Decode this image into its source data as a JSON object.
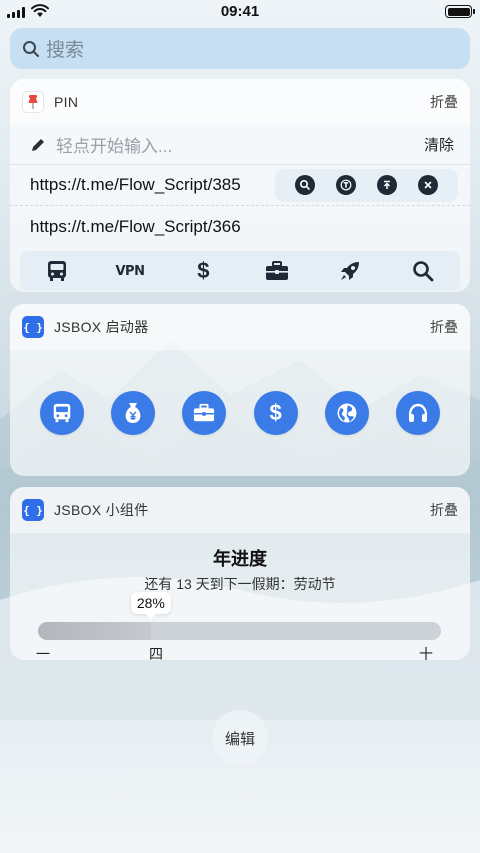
{
  "status_bar": {
    "time": "09:41"
  },
  "search": {
    "placeholder": "搜索"
  },
  "pin_widget": {
    "title": "PIN",
    "fold_label": "折叠",
    "input_hint": "轻点开始输入...",
    "clear_label": "清除",
    "clips": [
      "https://t.me/Flow_Script/385",
      "https://t.me/Flow_Script/366"
    ],
    "toolbar": {
      "vpn_label": "VPN",
      "dollar_label": "$"
    }
  },
  "launcher_widget": {
    "title": "JSBOX 启动器",
    "fold_label": "折叠",
    "icon_label": "{ }",
    "buttons": [
      "bus-icon",
      "money-bag-icon",
      "briefcase-icon",
      "dollar-icon",
      "globe-icon",
      "headphones-icon"
    ],
    "dollar_label": "$"
  },
  "small_widget": {
    "title": "JSBOX 小组件",
    "fold_label": "折叠",
    "icon_label": "{ }",
    "year_title": "年进度",
    "subtitle": "还有 13 天到下一假期：劳动节",
    "progress_label": "28%",
    "progress": 0.28,
    "ticks": [
      "一",
      "四",
      "十二"
    ]
  },
  "edit_label": "编辑",
  "colors": {
    "accent": "#3a7be8",
    "dark_icon": "#1f2a37",
    "jsbox_icon": "#2f6ee8"
  }
}
